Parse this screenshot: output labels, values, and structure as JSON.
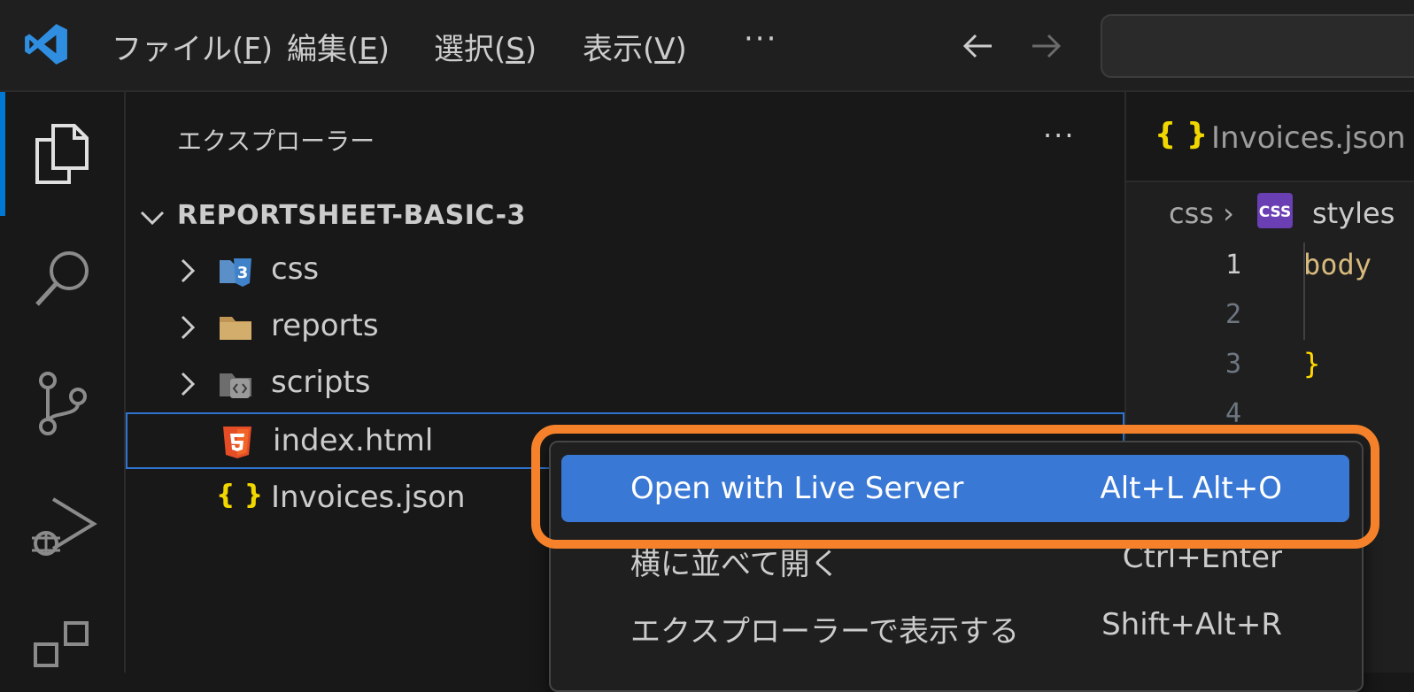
{
  "menu": {
    "file": "ファイル(",
    "file_key": "F",
    "edit": "編集(",
    "edit_key": "E",
    "select": "選択(",
    "select_key": "S",
    "view": "表示(",
    "view_key": "V",
    "close_paren": ")",
    "more": "···"
  },
  "sidebar": {
    "title": "エクスプローラー",
    "more": "···",
    "root": "REPORTSHEET-BASIC-3",
    "items": [
      {
        "label": "css",
        "icon": "css-folder-icon",
        "type": "folder"
      },
      {
        "label": "reports",
        "icon": "folder-icon",
        "type": "folder"
      },
      {
        "label": "scripts",
        "icon": "scripts-folder-icon",
        "type": "folder"
      },
      {
        "label": "index.html",
        "icon": "html5-icon",
        "type": "file",
        "selected": true
      },
      {
        "label": "Invoices.json",
        "icon": "json-braces-icon",
        "type": "file"
      }
    ]
  },
  "editor": {
    "tab_icon": "{ }",
    "tab_label": "Invoices.json",
    "breadcrumb_folder": "css  ›",
    "breadcrumb_badge": "CSS",
    "breadcrumb_file": "styles",
    "line_numbers": [
      "1",
      "2",
      "3",
      "4"
    ],
    "code": {
      "line1": "body",
      "line3": "}"
    }
  },
  "context_menu": {
    "items": [
      {
        "label": "Open with Live Server",
        "shortcut": "Alt+L Alt+O"
      },
      {
        "label": "横に並べて開く",
        "shortcut": "Ctrl+Enter"
      },
      {
        "label": "エクスプローラーで表示する",
        "shortcut": "Shift+Alt+R"
      }
    ]
  },
  "colors": {
    "accent": "#0078d4",
    "highlight": "#f5822a",
    "menu_active": "#3a78d6",
    "selection_border": "#2f74d0"
  }
}
